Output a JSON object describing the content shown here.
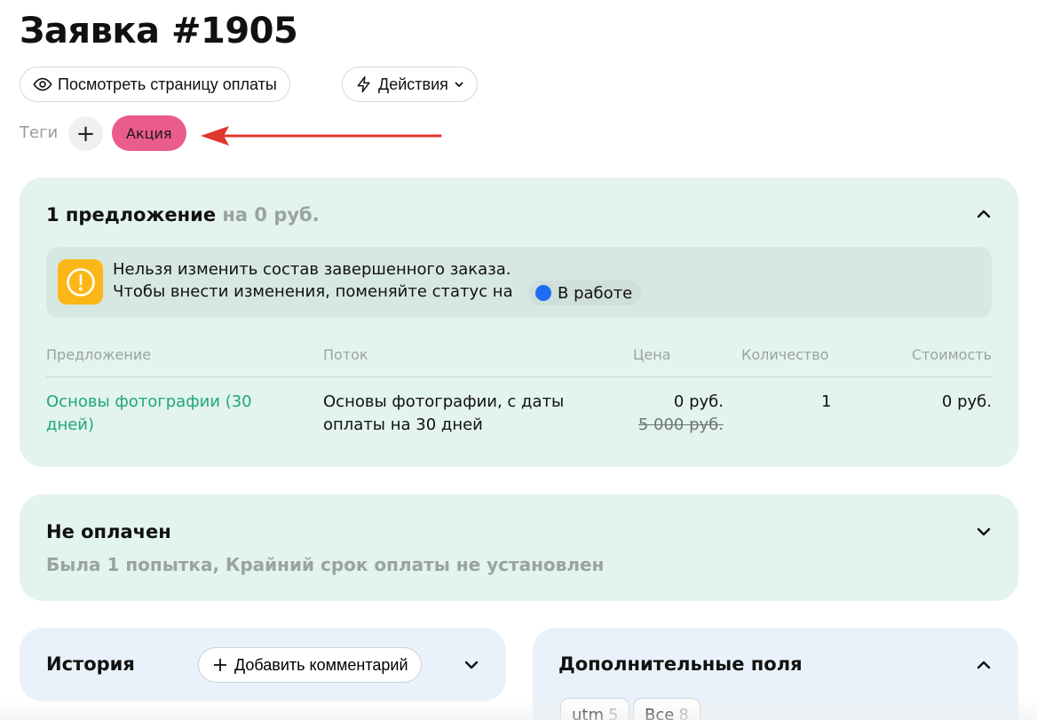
{
  "page": {
    "title": "Заявка #1905"
  },
  "toolbar": {
    "view_payment_label": "Посмотреть страницу оплаты",
    "actions_label": "Действия"
  },
  "tags": {
    "label": "Теги",
    "add_glyph": "+",
    "items": [
      {
        "label": "Акция",
        "color": "#ea5b8e"
      }
    ]
  },
  "offers": {
    "count_label": "1 предложение",
    "sum_label": "на 0 руб.",
    "notice": {
      "line1": "Нельзя изменить состав завершенного заказа.",
      "line2": "Чтобы внести изменения, поменяйте статус на",
      "status_label": "В работе",
      "status_color": "#1f6cf2",
      "icon": "exclamation-circle-icon"
    },
    "columns": [
      "Предложение",
      "Поток",
      "Цена",
      "Количество",
      "Стоимость"
    ],
    "rows": [
      {
        "offer": "Основы фотографии (30 дней)",
        "stream": "Основы фотографии, с даты оплаты на 30 дней",
        "price": "0 руб.",
        "old_price": "5 000 руб.",
        "quantity": "1",
        "total": "0 руб."
      }
    ]
  },
  "payment": {
    "title": "Не оплачен",
    "subtitle": "Была 1 попытка, Крайний срок оплаты не установлен"
  },
  "history": {
    "title": "История",
    "add_comment_label": "Добавить комментарий"
  },
  "extra_fields": {
    "title": "Дополнительные поля",
    "tabs": [
      {
        "label": "utm",
        "count": "5"
      },
      {
        "label": "Все",
        "count": "8"
      }
    ]
  },
  "colors": {
    "accent_green": "#1ea77a",
    "notice_yellow": "#fbb718",
    "card_green": "#e3f3ee",
    "card_blue": "#e9f2fa",
    "annotation_red": "#e0372c"
  }
}
